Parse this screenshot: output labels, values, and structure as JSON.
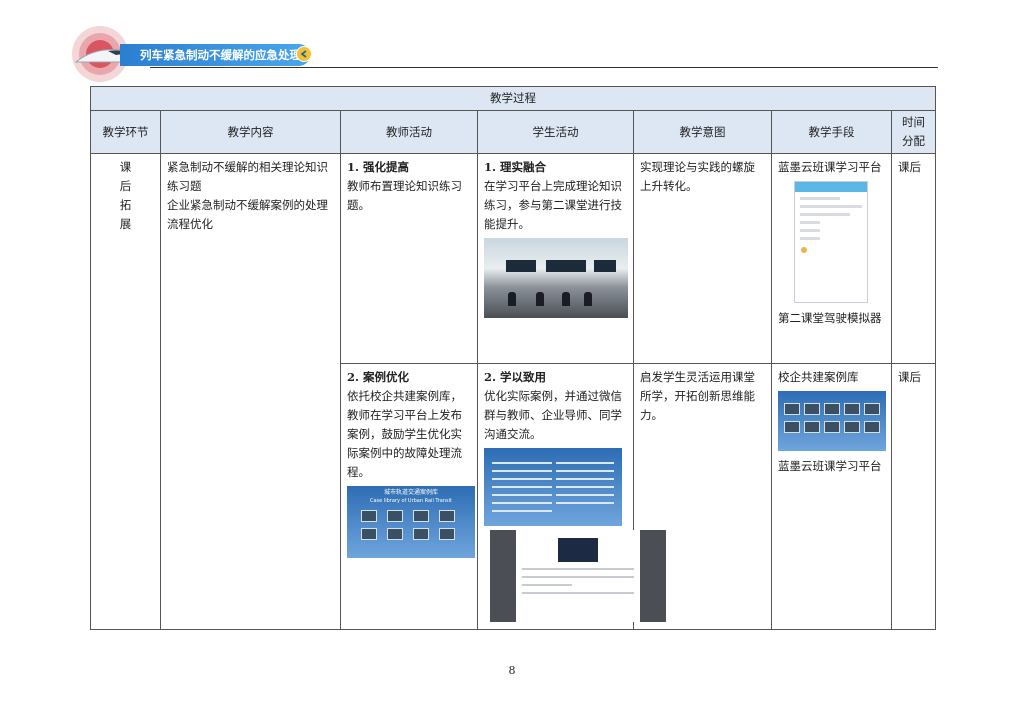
{
  "header": {
    "title": "列车紧急制动不缓解的应急处理"
  },
  "table": {
    "caption": "教学过程",
    "columns": [
      "教学环节",
      "教学内容",
      "教师活动",
      "学生活动",
      "教学意图",
      "教学手段",
      "时间分配"
    ],
    "col_time_line1": "时间",
    "col_time_line2": "分配",
    "phase_chars": [
      "课",
      "后",
      "拓",
      "展"
    ],
    "content_lines": [
      "紧急制动不缓解的相关理论知识练习题",
      "企业紧急制动不缓解案例的处理流程优化"
    ],
    "row1": {
      "teacher_title": "1. 强化提高",
      "teacher_text": "教师布置理论知识练习题。",
      "student_title": "1. 理实融合",
      "student_text": "在学习平台上完成理论知识练习，参与第二课堂进行技能提升。",
      "intent": "实现理论与实践的螺旋上升转化。",
      "means_top": "蓝墨云班课学习平台",
      "means_bottom": "第二课堂驾驶模拟器",
      "time": "课后"
    },
    "row2": {
      "teacher_title": "2. 案例优化",
      "teacher_text": "依托校企共建案例库，教师在学习平台上发布案例，鼓励学生优化实际案例中的故障处理流程。",
      "student_title": "2. 学以致用",
      "student_text": "优化实际案例，并通过微信群与教师、企业导师、同学沟通交流。",
      "intent": "启发学生灵活运用课堂所学，开拓创新思维能力。",
      "means_top": "校企共建案例库",
      "means_bottom": "蓝墨云班课学习平台",
      "time": "课后",
      "screenshot_title": "城市轨道交通案例库",
      "screenshot_subtitle": "Case library of Urban Rail Transit"
    }
  },
  "page_number": "8",
  "colors": {
    "header_bar": "#2b7fd1",
    "table_header_bg": "#dde7f3",
    "badge": "#f2c230"
  }
}
